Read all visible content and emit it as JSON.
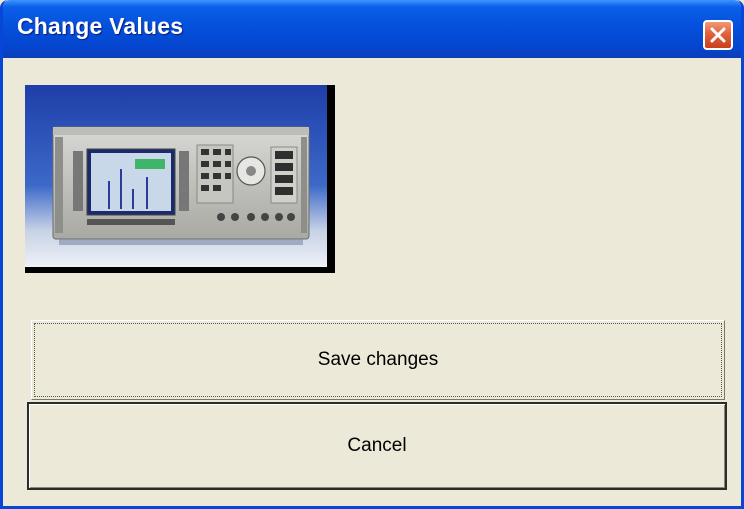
{
  "window": {
    "title": "Change Values"
  },
  "image": {
    "alt": "instrument-photo"
  },
  "buttons": {
    "save_label": "Save changes",
    "cancel_label": "Cancel"
  },
  "colors": {
    "titlebar": "#0550dc",
    "close_button": "#e2623a",
    "dialog_background": "#ece9d8"
  }
}
